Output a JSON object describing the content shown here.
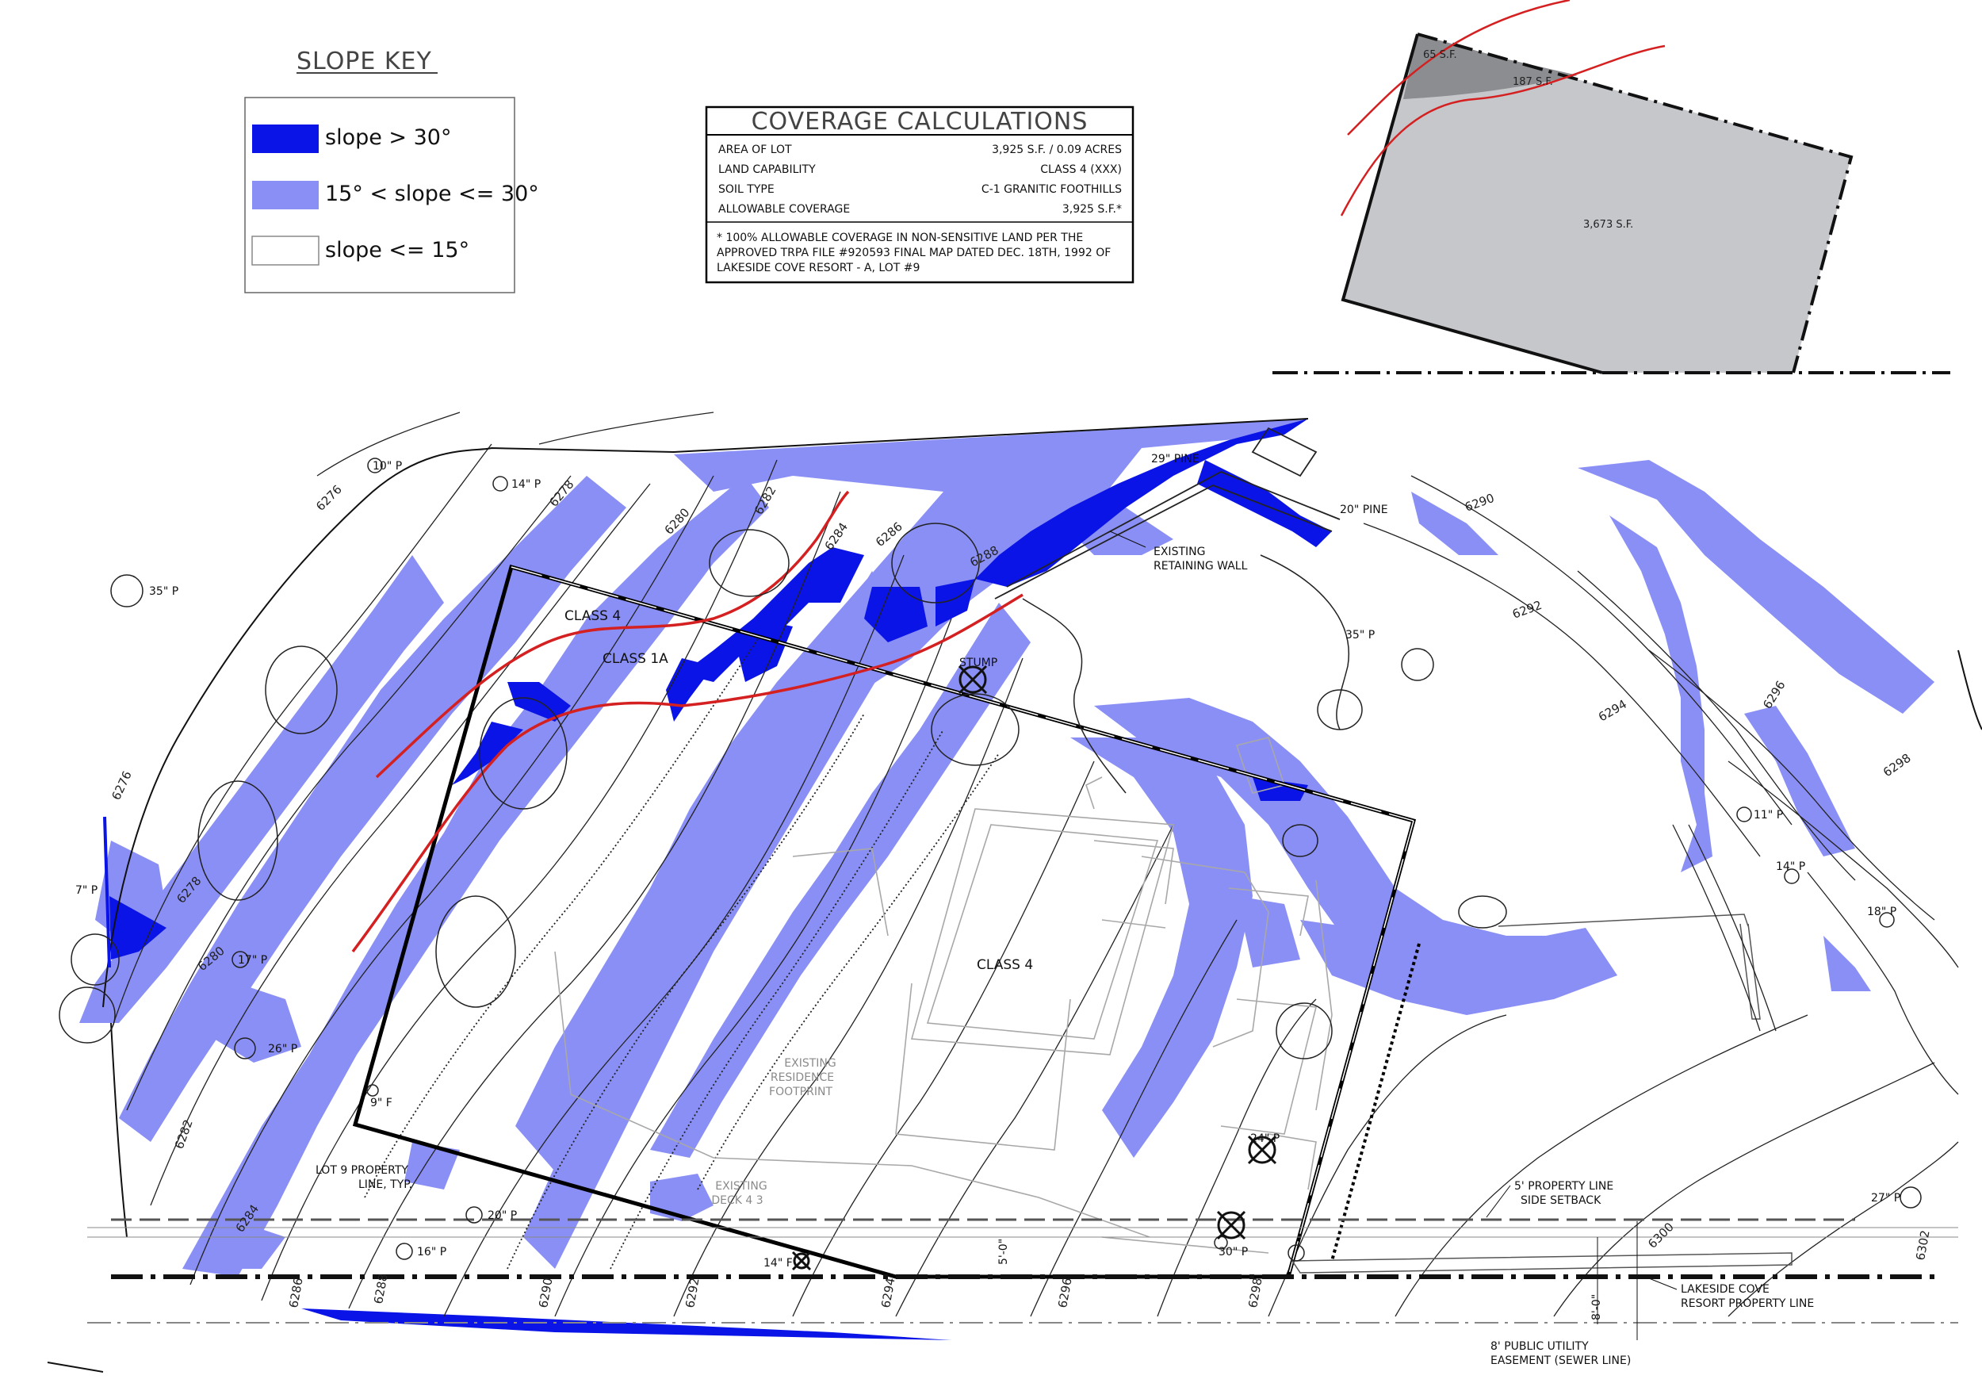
{
  "slope_key": {
    "title": "SLOPE KEY",
    "items": [
      {
        "label": "slope > 30°",
        "color": "#0a14e6"
      },
      {
        "label": "15° < slope <= 30°",
        "color": "#8a8ff5"
      },
      {
        "label": "slope <= 15°",
        "color": "#ffffff"
      }
    ]
  },
  "coverage": {
    "title": "COVERAGE CALCULATIONS",
    "rows": [
      {
        "label": "AREA OF LOT",
        "value": "3,925 S.F. / 0.09 ACRES"
      },
      {
        "label": "LAND CAPABILITY",
        "value": "CLASS 4 (XXX)"
      },
      {
        "label": "SOIL TYPE",
        "value": "C-1 GRANITIC FOOTHILLS"
      },
      {
        "label": "ALLOWABLE COVERAGE",
        "value": "3,925 S.F.*"
      }
    ],
    "note_lines": [
      "* 100% ALLOWABLE COVERAGE IN NON-SENSITIVE LAND PER THE",
      "APPROVED TRPA FILE #920593 FINAL MAP DATED DEC. 18TH, 1992 OF",
      "LAKESIDE COVE RESORT - A, LOT #9"
    ]
  },
  "inset": {
    "area_a": "65 S.F.",
    "area_b": "187 S.F.",
    "area_c": "3,673 S.F."
  },
  "colors": {
    "steep": "#0a14e6",
    "moderate": "#8a8ff5",
    "class_line": "#d42020",
    "inset_fill": "#c6c7cb",
    "inset_dark": "#8c8d90"
  },
  "map": {
    "trees": {
      "t10": "10\" P",
      "t14a": "14\" P",
      "t35a": "35\" P",
      "t35b": "35\" P",
      "t29": "29\" PINE",
      "t20pine": "20\" PINE",
      "t11": "11\" P",
      "t14b": "14\" P",
      "t18": "18\" P",
      "t7": "7\" P",
      "t17": "17\" P",
      "t26": "26\" P",
      "t9": "9\" F",
      "t20": "20\" P",
      "t16": "16\" P",
      "t14f": "14\" F",
      "t24": "24\" P",
      "t30": "30\" P",
      "t27": "27\" P",
      "stump": "STUMP"
    },
    "contours": {
      "c6276a": "6276",
      "c6278a": "6278",
      "c6280a": "6280",
      "c6282a": "6282",
      "c6284a": "6284",
      "c6286a": "6286",
      "c6288a": "6288",
      "c6290a": "6290",
      "c6292a": "6292",
      "c6294a": "6294",
      "c6296a": "6296",
      "c6298a": "6298",
      "c6276b": "6276",
      "c6278b": "6278",
      "c6280b": "6280",
      "c6282b": "6282",
      "c6284b": "6284",
      "c6286b": "6286",
      "c6288b": "6288",
      "c6290b": "6290",
      "c6292b": "6292",
      "c6294b": "6294",
      "c6296b": "6296",
      "c6298b": "6298",
      "c6300": "6300",
      "c6302": "6302"
    },
    "labels": {
      "existing_wall_1": "EXISTING",
      "existing_wall_2": "RETAINING WALL",
      "class4_top": "CLASS 4",
      "class1a": "CLASS 1A",
      "class4_mid": "CLASS 4",
      "residence_1": "EXISTING",
      "residence_2": "RESIDENCE",
      "residence_3": "FOOTPRINT",
      "deck_1": "EXISTING",
      "deck_2": "DECK 4 3",
      "lot_1": "LOT 9 PROPERTY",
      "lot_2": "LINE, TYP.",
      "setback_1": "5' PROPERTY LINE",
      "setback_2": "SIDE SETBACK",
      "resort_1": "LAKESIDE COVE",
      "resort_2": "RESORT PROPERTY LINE",
      "easement_1": "8' PUBLIC UTILITY",
      "easement_2": "EASEMENT (SEWER LINE)",
      "dim_5": "5'-0\"",
      "dim_8": "8'-0\""
    }
  }
}
